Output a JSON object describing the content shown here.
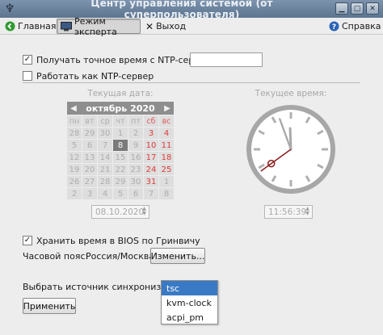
{
  "window": {
    "title": "Центр управления системой (от суперпользователя)",
    "buttons": [
      "▁",
      "▢",
      "✕"
    ]
  },
  "toolbar": {
    "home_label": "Главная",
    "expert_label": "Режим эксперта",
    "exit_label": "Выход",
    "help_label": "Справка"
  },
  "ntp": {
    "get_time_label": "Получать точное время с NTP-сервера:",
    "get_time_checked": true,
    "server_value": "",
    "act_as_server_label": "Работать как NTP-сервер",
    "act_as_server_checked": false
  },
  "calendar": {
    "caption": "Текущая дата:",
    "month_label": "октябрь",
    "year_label": "2020",
    "prev": "◀",
    "next": "▶",
    "weekdays": [
      "пн",
      "вт",
      "ср",
      "чт",
      "пт",
      "сб",
      "вс"
    ],
    "weeks": [
      [
        "28",
        "29",
        "30",
        "1",
        "2",
        "3",
        "4"
      ],
      [
        "5",
        "6",
        "7",
        "8",
        "9",
        "10",
        "11"
      ],
      [
        "12",
        "13",
        "14",
        "15",
        "16",
        "17",
        "18"
      ],
      [
        "19",
        "20",
        "21",
        "22",
        "23",
        "24",
        "25"
      ],
      [
        "26",
        "27",
        "28",
        "29",
        "30",
        "31",
        "1"
      ],
      [
        "2",
        "3",
        "4",
        "5",
        "6",
        "7",
        "8"
      ]
    ],
    "selected_day": "8",
    "date_value": "08.10.2020"
  },
  "clock": {
    "caption": "Текущее время:",
    "time_value": "11:56:39",
    "hour": 11,
    "minute": 56,
    "second": 39
  },
  "bios": {
    "label": "Хранить время в BIOS по Гринвичу",
    "checked": true
  },
  "timezone": {
    "label": "Часовой пояс:",
    "value": "Россия/Москва",
    "change_button": "Изменить..."
  },
  "sync": {
    "label": "Выбрать источник синхронизации:",
    "options": [
      "tsc",
      "kvm-clock",
      "acpi_pm"
    ],
    "selected": "tsc"
  },
  "apply_button": "Применить",
  "colors": {
    "accent": "#3a7ac4",
    "titlebar": "#6b829e",
    "weekend": "#e03a3a",
    "second_hand": "#8a1c1c"
  }
}
